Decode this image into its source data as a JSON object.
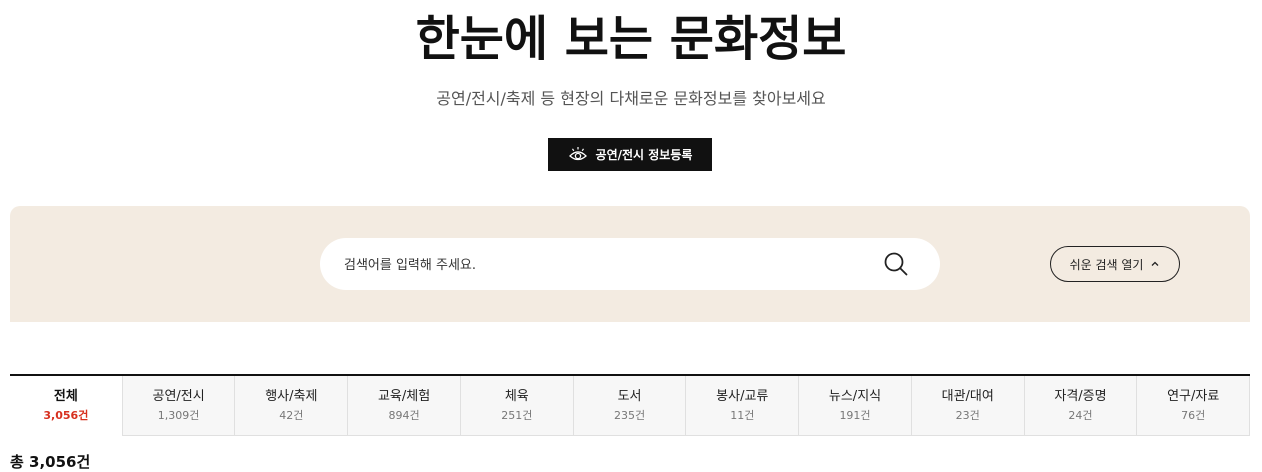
{
  "header": {
    "title": "한눈에 보는 문화정보",
    "subtitle": "공연/전시/축제 등 현장의 다채로운 문화정보를 찾아보세요",
    "register_button": "공연/전시 정보등록"
  },
  "search": {
    "placeholder": "검색어를 입력해 주세요.",
    "easy_search_label": "쉬운 검색 열기"
  },
  "tabs": [
    {
      "label": "전체",
      "count": "3,056건"
    },
    {
      "label": "공연/전시",
      "count": "1,309건"
    },
    {
      "label": "행사/축제",
      "count": "42건"
    },
    {
      "label": "교육/체험",
      "count": "894건"
    },
    {
      "label": "체육",
      "count": "251건"
    },
    {
      "label": "도서",
      "count": "235건"
    },
    {
      "label": "봉사/교류",
      "count": "11건"
    },
    {
      "label": "뉴스/지식",
      "count": "191건"
    },
    {
      "label": "대관/대여",
      "count": "23건"
    },
    {
      "label": "자격/증명",
      "count": "24건"
    },
    {
      "label": "연구/자료",
      "count": "76건"
    }
  ],
  "results": {
    "total_label": "총 3,056건"
  },
  "colors": {
    "panel_bg": "#f3ebe1",
    "accent_red": "#d7301f",
    "button_dark": "#111111"
  }
}
